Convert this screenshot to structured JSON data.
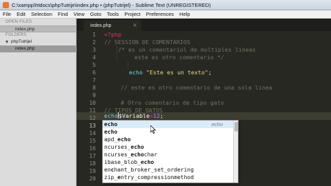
{
  "window": {
    "title": "C:\\xampp\\htdocs\\phpTutrije\\index.php • (phpTutrijel) - Sublime Text (UNREGISTERED)"
  },
  "menu": [
    "File",
    "Edit",
    "Selection",
    "Find",
    "View",
    "Goto",
    "Tools",
    "Project",
    "Preferences",
    "Help"
  ],
  "sidebar": {
    "open_files_header": "OPEN FILES",
    "open_file": "index.php",
    "folders_header": "FOLDERS",
    "folder": "phpTutrijel",
    "folder_file": "index.php"
  },
  "tab": {
    "label": "index.php",
    "close": "×"
  },
  "editor": {
    "line_numbers": [
      "1",
      "2",
      "3",
      "4",
      "5",
      "6",
      "7",
      "8",
      "9",
      "10",
      "11",
      "12",
      "13",
      "14",
      "15",
      "16",
      "17",
      "18",
      "19",
      "20"
    ],
    "active_line": "13",
    "lines": {
      "l1": "<?php",
      "l2": "// SESSION DE COMENTARIOS",
      "l3": "/* es un comentariol de multiples lineas",
      "l4": "este es otro comentario */",
      "l6_kw": "echo",
      "l6_str": "\"Este es un texto\"",
      "l6_end": ";",
      "l8": "// este es otro comentario de una sola linea",
      "l10": "# Otro comentario de tipo gato",
      "l12": "// TIPOS DE DATOS",
      "l13_kw": "echo",
      "l13_var": "$Variable",
      "l13_op": "=",
      "l13_num": "12",
      "l13_end": ";"
    }
  },
  "autocomplete": {
    "hint": "echo",
    "items": [
      {
        "pre": "",
        "bold": "echo",
        "post": ""
      },
      {
        "pre": "",
        "bold": "echo",
        "post": ""
      },
      {
        "pre": "apd_",
        "bold": "echo",
        "post": ""
      },
      {
        "pre": "ncurses_",
        "bold": "echo",
        "post": ""
      },
      {
        "pre": "ncurses_",
        "bold": "echo",
        "post": "char"
      },
      {
        "pre": "ibase_blob_",
        "bold": "echo",
        "post": ""
      },
      {
        "pre": "en",
        "bold": "c",
        "post": "hant_broker_set_ordering"
      },
      {
        "pre": "zip_",
        "bold": "e",
        "post": "ntry_compressionmethod"
      }
    ]
  }
}
